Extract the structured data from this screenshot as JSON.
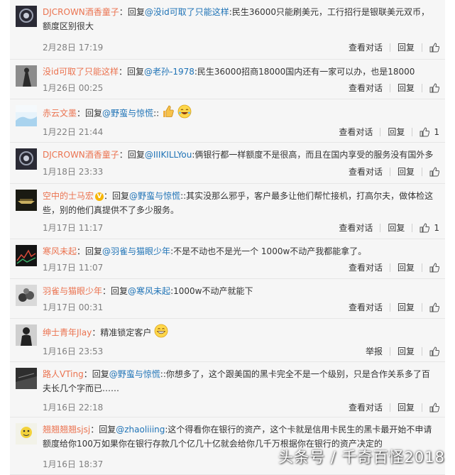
{
  "common": {
    "reply_word": "回复",
    "view_convo": "查看对话",
    "reply_btn": "回复",
    "report_btn": "举报"
  },
  "comments": [
    {
      "user": "DJCROWN酒香童子",
      "colon": "：",
      "target": "@没id可取了只能这样",
      "text": ":民生36000只能刷美元，工行招行是银联美元双币，额度区别很大",
      "time": "2月28日 17:19"
    },
    {
      "user": "没id可取了只能这样",
      "colon": "：",
      "target": "@老孙-1978",
      "text": ":民生36000招商18000国内还有一家可以办，也是18000",
      "time": "1月26日 00:25"
    },
    {
      "user": "赤云文墨",
      "colon": "：",
      "target": "@野蛮与惊慌",
      "text": "::",
      "time": "1月22日 21:44",
      "likes": "1"
    },
    {
      "user": "DJCROWN酒香童子",
      "colon": "：",
      "target": "@IIIKILLYou",
      "text": ":俩银行都一样额度不是很高，而且在国内享受的服务没有国外多",
      "time": "1月18日 23:33"
    },
    {
      "user": "空中的士马宏",
      "colon": "：",
      "target": "@野蛮与惊慌",
      "text": "::其实没那么邪乎，客户最多让他们帮忙接机，打高尔夫，做体检这些，别的他们真提供不了多少服务。",
      "time": "1月17日 11:17",
      "likes": "1"
    },
    {
      "user": "寒风未起",
      "colon": "：",
      "target": "@羽雀与猫眼少年",
      "text": ":不是不动也不是光一个 1000w不动产我都能拿了。",
      "time": "1月17日 11:07"
    },
    {
      "user": "羽雀与猫眼少年",
      "colon": "：",
      "target": "@寒风未起",
      "text": ":1000w不动产就能下",
      "time": "1月17日 00:31"
    },
    {
      "user": "绅士青年Jlay",
      "colon": "：",
      "text": "精准锁定客户",
      "time": "1月16日 23:53"
    },
    {
      "user": "路人VTing",
      "colon": "：",
      "target": "@野蛮与惊慌",
      "text": "::你想多了，这个跟美国的黑卡完全不是一个级别，只是合作关系多了百夫长几个字而已……",
      "time": "1月16日 22:18"
    },
    {
      "user": "翘翘翘翘sjsj",
      "colon": "：",
      "target": "@zhaoliiing",
      "text": ":这个得看你在银行的资产，这个卡就是信用卡民生的黑卡最开始不申请额度给你100万如果你在银行存款几个亿几十亿就会给你几千万根据你在银行的资产决定的",
      "time": "1月16日 18:37"
    }
  ],
  "watermark": "头条号 / 千奇百怪2018",
  "colors": {
    "username": "#eb7350",
    "mention": "#1f73b6",
    "row_bg": "#f6f6f6"
  }
}
